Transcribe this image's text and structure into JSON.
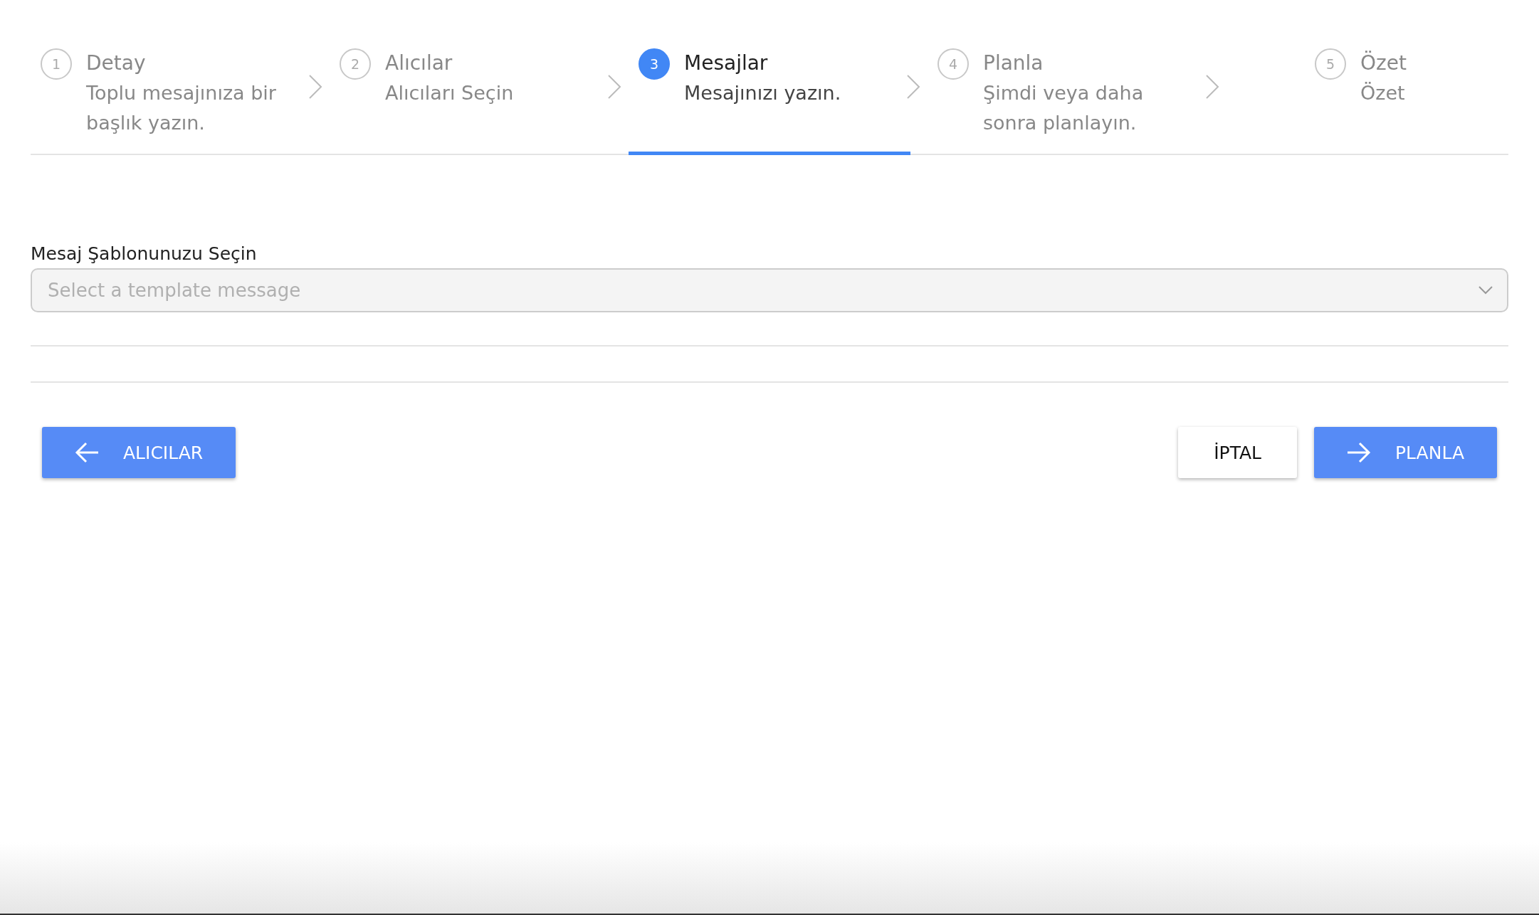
{
  "steps": [
    {
      "number": "1",
      "title": "Detay",
      "description": "Toplu mesajınıza bir başlık yazın.",
      "selected": false
    },
    {
      "number": "2",
      "title": "Alıcılar",
      "description": "Alıcıları Seçin",
      "selected": false
    },
    {
      "number": "3",
      "title": "Mesajlar",
      "description": "Mesajınızı yazın.",
      "selected": true
    },
    {
      "number": "4",
      "title": "Planla",
      "description": "Şimdi veya daha sonra planlayın.",
      "selected": false
    },
    {
      "number": "5",
      "title": "Özet",
      "description": "Özet",
      "selected": false
    }
  ],
  "template_select": {
    "label": "Mesaj Şablonunuzu Seçin",
    "placeholder": "Select a template message"
  },
  "buttons": [
    {
      "kind": "back",
      "label": "ALICILAR"
    },
    {
      "kind": "cancel",
      "label": "İPTAL"
    },
    {
      "kind": "next",
      "label": "PLANLA"
    }
  ]
}
